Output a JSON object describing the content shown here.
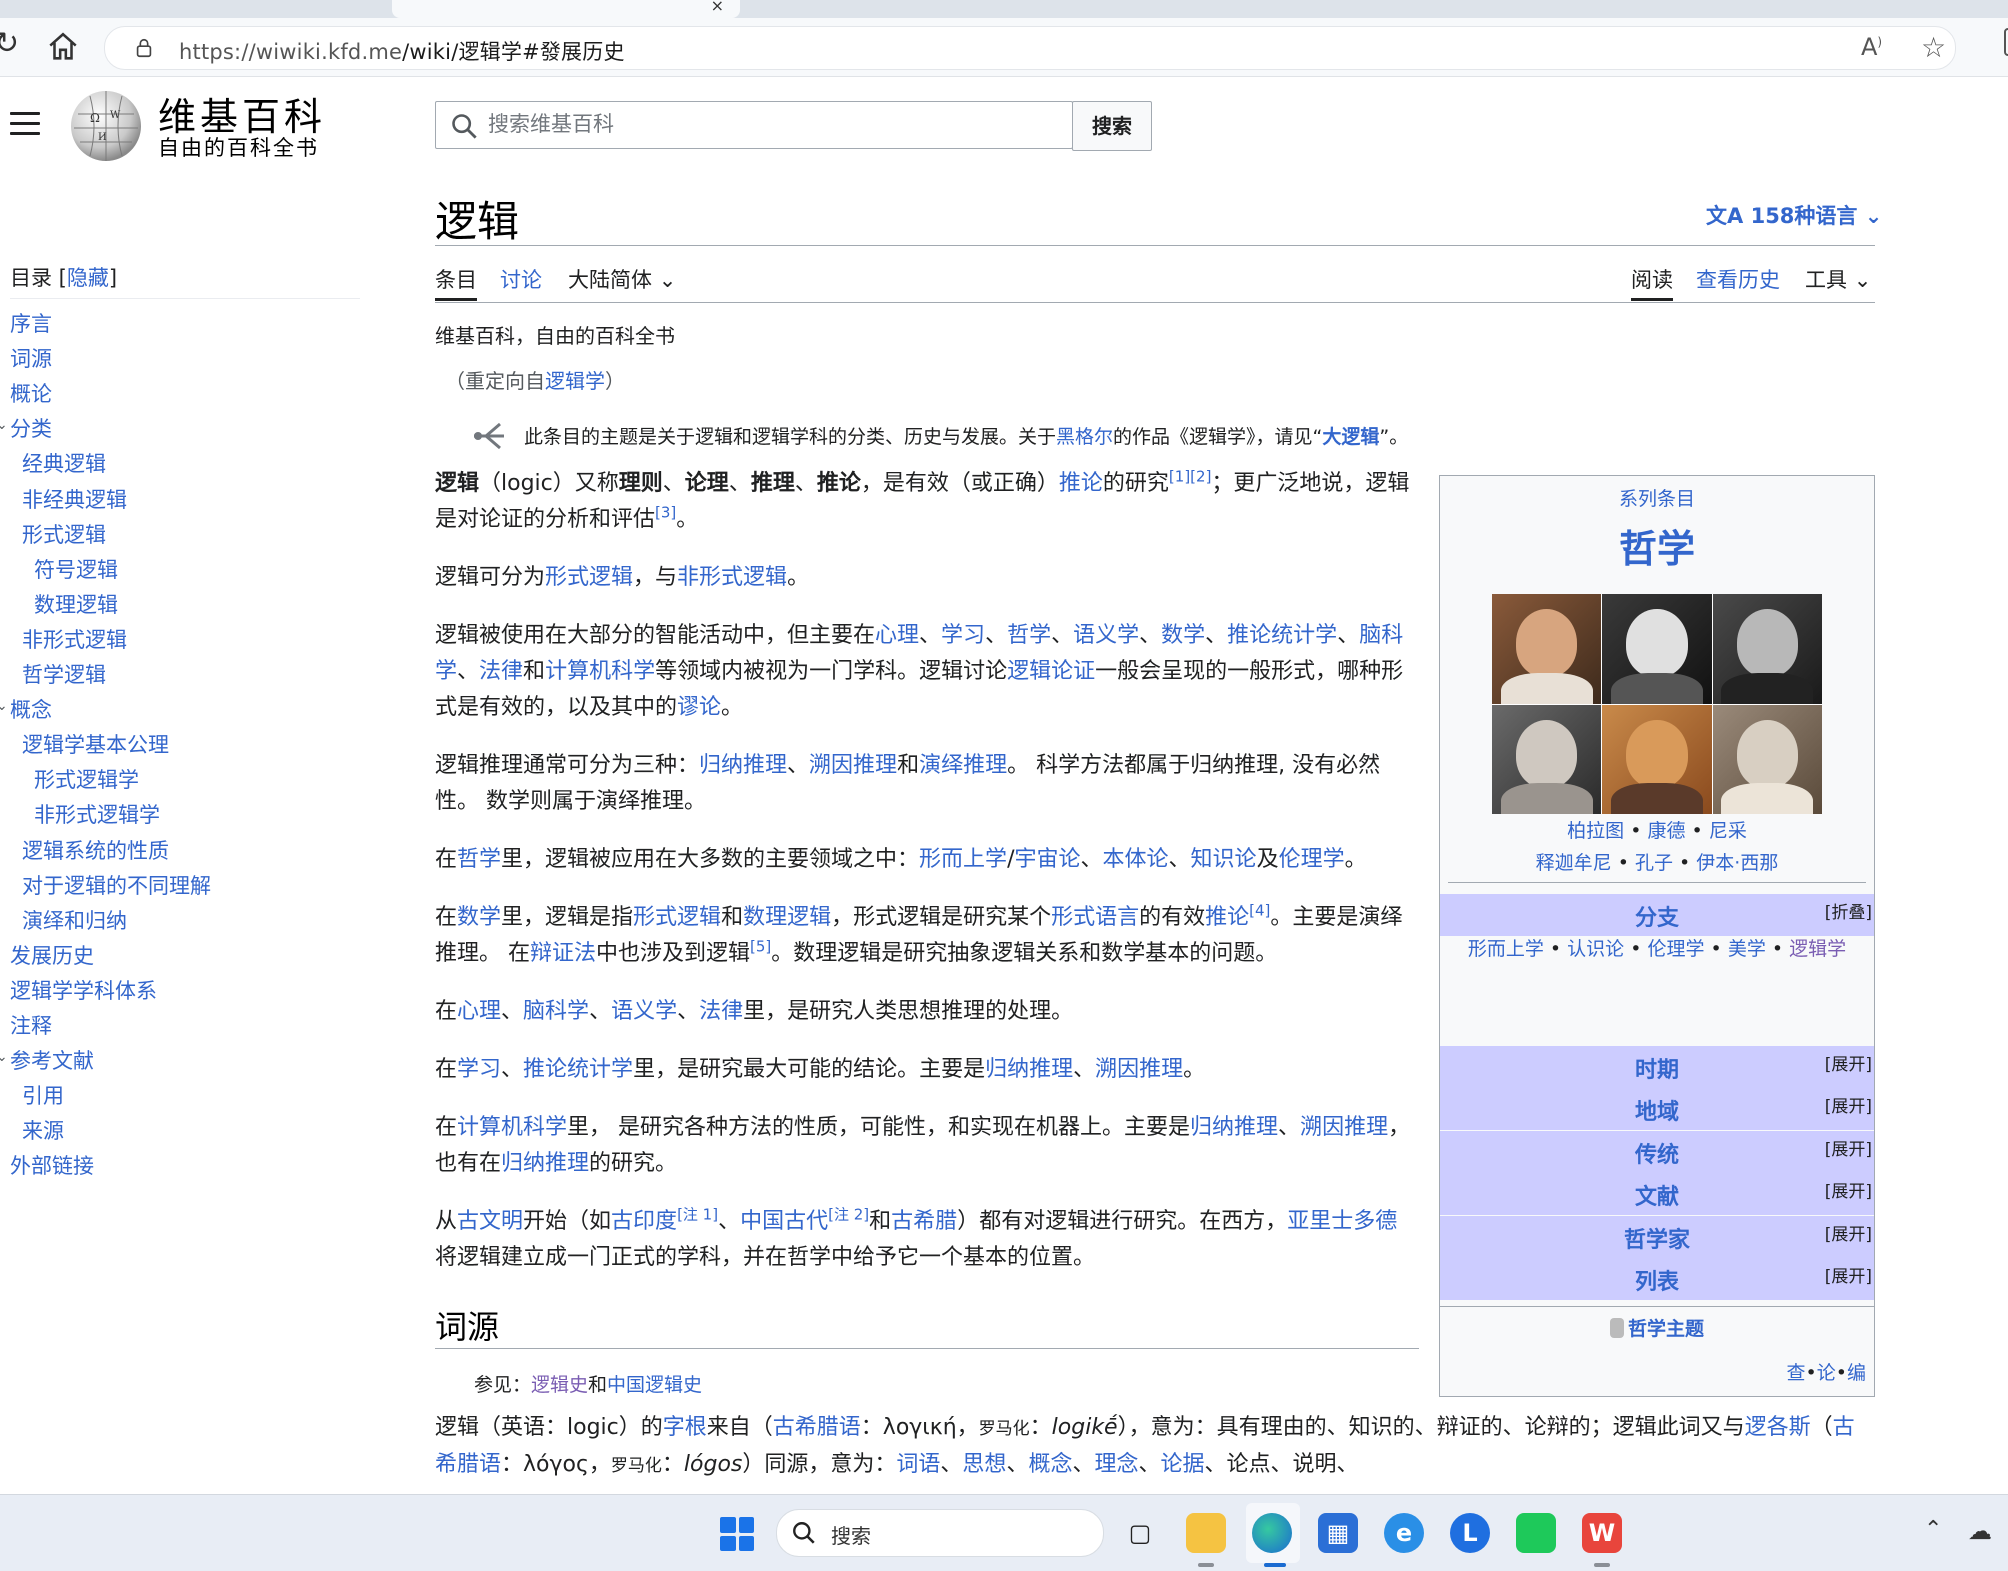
{
  "browser": {
    "url_host": "https://wiwiki.kfd.me",
    "url_path": "/wiki/逻辑学#發展历史"
  },
  "wiki": {
    "logo_title": "维基百科",
    "logo_tagline": "自由的百科全书",
    "search_placeholder": "搜索维基百科",
    "search_button": "搜索"
  },
  "toc": {
    "header": "目录",
    "hide_link": "隐藏",
    "items": [
      {
        "label": "序言",
        "level": 0
      },
      {
        "label": "词源",
        "level": 0
      },
      {
        "label": "概论",
        "level": 0
      },
      {
        "label": "分类",
        "level": 0
      },
      {
        "label": "经典逻辑",
        "level": 1
      },
      {
        "label": "非经典逻辑",
        "level": 1
      },
      {
        "label": "形式逻辑",
        "level": 1
      },
      {
        "label": "符号逻辑",
        "level": 2
      },
      {
        "label": "数理逻辑",
        "level": 2
      },
      {
        "label": "非形式逻辑",
        "level": 1
      },
      {
        "label": "哲学逻辑",
        "level": 1
      },
      {
        "label": "概念",
        "level": 0
      },
      {
        "label": "逻辑学基本公理",
        "level": 1
      },
      {
        "label": "形式逻辑学",
        "level": 2
      },
      {
        "label": "非形式逻辑学",
        "level": 2
      },
      {
        "label": "逻辑系统的性质",
        "level": 1
      },
      {
        "label": "对于逻辑的不同理解",
        "level": 1
      },
      {
        "label": "演绎和归纳",
        "level": 1
      },
      {
        "label": "发展历史",
        "level": 0
      },
      {
        "label": "逻辑学学科体系",
        "level": 0
      },
      {
        "label": "注释",
        "level": 0
      },
      {
        "label": "参考文献",
        "level": 0
      },
      {
        "label": "引用",
        "level": 1
      },
      {
        "label": "来源",
        "level": 1
      },
      {
        "label": "外部链接",
        "level": 0
      }
    ]
  },
  "article": {
    "title": "逻辑",
    "languages": "158种语言",
    "tabs": {
      "article": "条目",
      "talk": "讨论",
      "variant": "大陆简体",
      "read": "阅读",
      "history": "查看历史",
      "tools": "工具"
    },
    "site_sub": "维基百科，自由的百科全书",
    "redirect": {
      "prefix": "（重定向自",
      "link": "逻辑学",
      "suffix": "）"
    },
    "hatnote": {
      "t1": "此条目的主题是关于逻辑和逻辑学科的分类、历史与发展。关于",
      "l1": "黑格尔",
      "t2": "的作品《逻辑学》，请见“",
      "l2": "大逻辑",
      "t3": "”。"
    },
    "p1": {
      "b1": "逻辑",
      "t1": "（logic）又称",
      "b2": "理则",
      "t2": "、",
      "b3": "论理",
      "t3": "、",
      "b4": "推理",
      "t4": "、",
      "b5": "推论",
      "t5": "，是有效（或正确）",
      "l1": "推论",
      "t6": "的研究",
      "s1": "[1]",
      "s2": "[2]",
      "t7": "；更广泛地说，逻辑是对论证的分析和评估",
      "s3": "[3]",
      "t8": "。"
    },
    "p2": {
      "t1": "逻辑可分为",
      "l1": "形式逻辑",
      "t2": "，与",
      "l2": "非形式逻辑",
      "t3": "。"
    },
    "p3": {
      "t1": "逻辑被使用在大部分的智能活动中，但主要在",
      "l1": "心理",
      "l2": "学习",
      "l3": "哲学",
      "l4": "语义学",
      "l5": "数学",
      "l6": "推论统计学",
      "l7": "脑科学",
      "l8": "法律",
      "t2": "和",
      "l9": "计算机科学",
      "t3": "等领域内被视为一门学科。逻辑讨论",
      "l10": "逻辑论证",
      "t4": "一般会呈现的一般形式，哪种形式是有效的，以及其中的",
      "l11": "谬论",
      "t5": "。",
      "sep": "、"
    },
    "p4": {
      "t1": "逻辑推理通常可分为三种：",
      "l1": "归纳推理",
      "t2": "、",
      "l2": "溯因推理",
      "t3": "和",
      "l3": "演绎推理",
      "t4": "。 科学方法都属于归纳推理, 没有必然性。 数学则属于演绎推理。"
    },
    "p5": {
      "t1": "在",
      "l1": "哲学",
      "t2": "里，逻辑被应用在大多数的主要领域之中：",
      "l2": "形而上学",
      "t3": "/",
      "l3": "宇宙论",
      "t4": "、",
      "l4": "本体论",
      "t5": "、",
      "l5": "知识论",
      "t6": "及",
      "l6": "伦理学",
      "t7": "。"
    },
    "p6": {
      "t1": "在",
      "l1": "数学",
      "t2": "里，逻辑是指",
      "l2": "形式逻辑",
      "t3": "和",
      "l3": "数理逻辑",
      "t4": "，形式逻辑是研究某个",
      "l4": "形式语言",
      "t5": "的有效",
      "l5": "推论",
      "s1": "[4]",
      "t6": "。主要是演绎推理。 在",
      "l6": "辩证法",
      "t7": "中也涉及到逻辑",
      "s2": "[5]",
      "t8": "。数理逻辑是研究抽象逻辑关系和数学基本的问题。"
    },
    "p7": {
      "t1": "在",
      "l1": "心理",
      "t2": "、",
      "l2": "脑科学",
      "t3": "、",
      "l3": "语义学",
      "t4": "、",
      "l4": "法律",
      "t5": "里，是研究人类思想推理的处理。"
    },
    "p8": {
      "t1": "在",
      "l1": "学习",
      "t2": "、",
      "l2": "推论统计学",
      "t3": "里，是研究最大可能的结论。主要是",
      "l3": "归纳推理",
      "t4": "、",
      "l4": "溯因推理",
      "t5": "。"
    },
    "p9": {
      "t1": "在",
      "l1": "计算机科学",
      "t2": "里， 是研究各种方法的性质，可能性，和实现在机器上。主要是",
      "l2": "归纳推理",
      "t3": "、",
      "l3": "溯因推理",
      "t4": "，也有在",
      "l4": "归纳推理",
      "t5": "的研究。"
    },
    "p10": {
      "t1": "从",
      "l1": "古文明",
      "t2": "开始（如",
      "l2": "古印度",
      "s1": "[注 1]",
      "t3": "、",
      "l3": "中国古代",
      "s2": "[注 2]",
      "t4": "和",
      "l4": "古希腊",
      "t5": "）都有对逻辑进行研究。在西方，",
      "l5": "亚里士多德",
      "t6": "将逻辑建立成一门正式的学科，并在哲学中给予它一个基本的位置。"
    },
    "section_etym": "词源",
    "seealso": {
      "t1": "参见：",
      "l1": "逻辑史",
      "t2": "和",
      "l2": "中国逻辑史"
    },
    "etym": {
      "t1": "逻辑（英语：logic）的",
      "l1": "字根",
      "t2": "来自（",
      "l2": "古希腊语",
      "t3": "：λογική，",
      "r1": "罗马化",
      "t4": "：",
      "i1": "logikḗ",
      "t5": "），意为：具有理由的、知识的、辩证的、论辩的；逻辑此词又与",
      "l3": "逻各斯",
      "t6": "（",
      "l4": "古希腊语",
      "t7": "：λόγος，",
      "r2": "罗马化",
      "t8": "：",
      "i2": "lógos",
      "t9": "）同源，意为：",
      "l5": "词语",
      "sep": "、",
      "l6": "思想",
      "l7": "概念",
      "l8": "理念",
      "l9": "论据",
      "t10": "、论点、说明、"
    }
  },
  "infobox": {
    "series": "系列条目",
    "title": "哲学",
    "names1": [
      "柏拉图",
      "康德",
      "尼采"
    ],
    "names2": [
      "释迦牟尼",
      "孔子",
      "伊本·西那"
    ],
    "dot": "•",
    "rows": [
      {
        "label": "分支",
        "toggle": "[折叠]"
      },
      {
        "label": "时期",
        "toggle": "[展开]"
      },
      {
        "label": "地域",
        "toggle": "[展开]"
      },
      {
        "label": "传统",
        "toggle": "[展开]"
      },
      {
        "label": "文献",
        "toggle": "[展开]"
      },
      {
        "label": "哲学家",
        "toggle": "[展开]"
      },
      {
        "label": "列表",
        "toggle": "[展开]"
      }
    ],
    "branches": [
      "形而上学",
      "认识论",
      "伦理学",
      "美学",
      "逻辑学"
    ],
    "portal": "哲学主题",
    "vte": [
      "查",
      "论",
      "编"
    ]
  },
  "taskbar": {
    "search_label": "搜索"
  },
  "colors": {
    "link": "#3366cc",
    "visited_link": "#795cb2",
    "infobox_row": "#ccccff",
    "taskbar": "#e8edf5"
  }
}
